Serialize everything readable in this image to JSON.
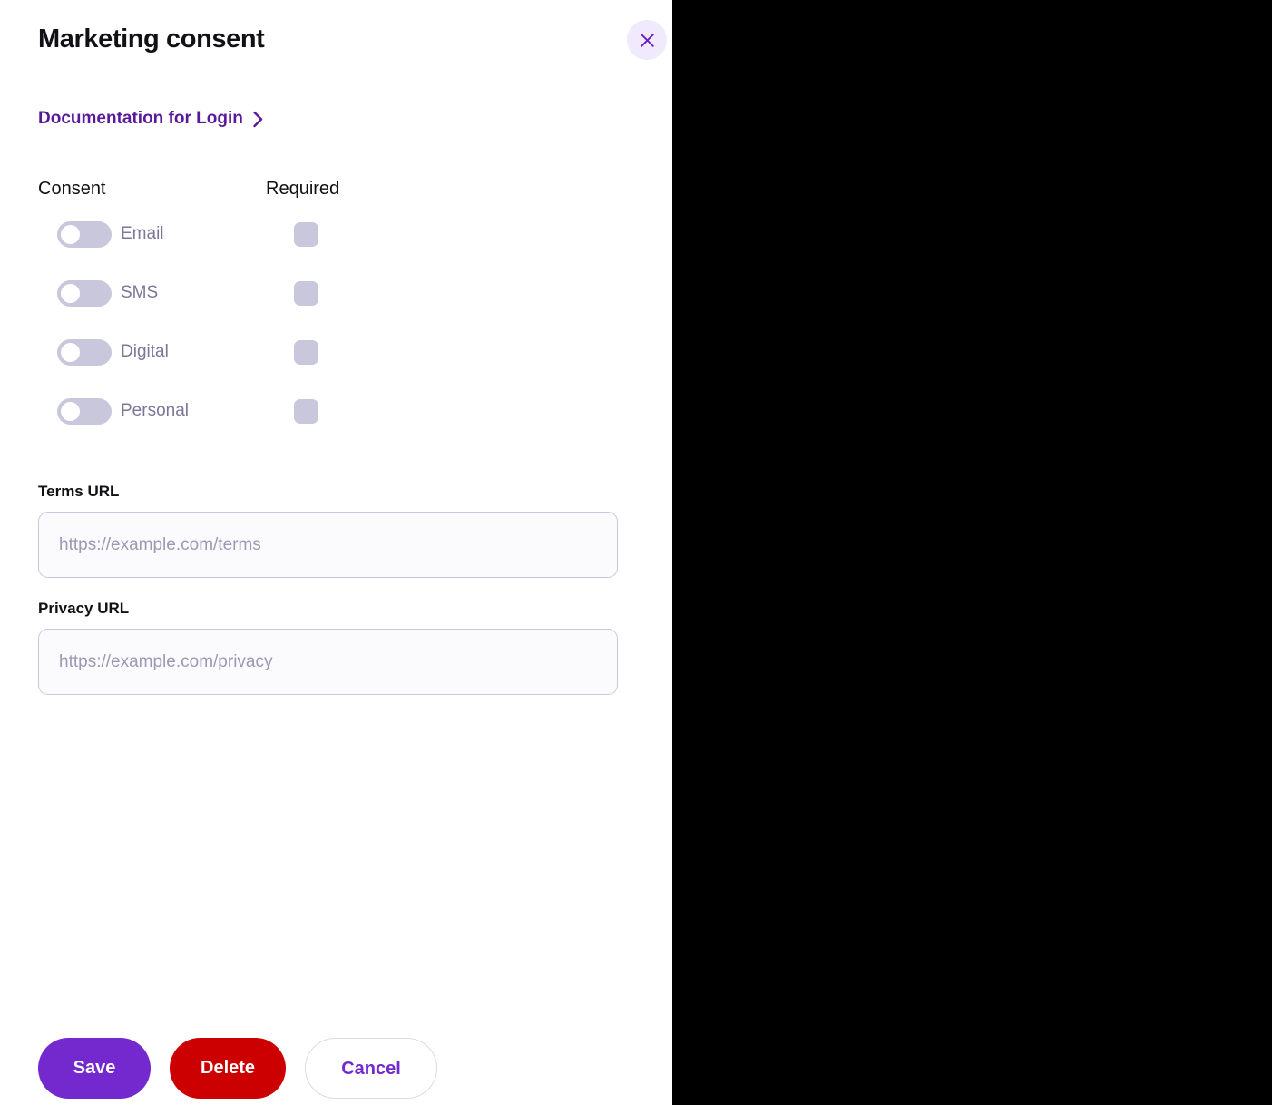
{
  "panel": {
    "title": "Marketing consent",
    "close_icon": "close-icon"
  },
  "doc_link": {
    "label": "Documentation for Login",
    "chevron_icon": "chevron-right-icon"
  },
  "consent_table": {
    "headers": {
      "consent": "Consent",
      "required": "Required"
    },
    "rows": [
      {
        "label": "Email",
        "toggle_state": "off",
        "required_state": "unchecked"
      },
      {
        "label": "SMS",
        "toggle_state": "off",
        "required_state": "unchecked"
      },
      {
        "label": "Digital",
        "toggle_state": "off",
        "required_state": "unchecked"
      },
      {
        "label": "Personal",
        "toggle_state": "off",
        "required_state": "unchecked"
      }
    ]
  },
  "fields": {
    "terms": {
      "label": "Terms URL",
      "value": "",
      "placeholder": "https://example.com/terms"
    },
    "privacy": {
      "label": "Privacy URL",
      "value": "",
      "placeholder": "https://example.com/privacy"
    }
  },
  "footer": {
    "save_label": "Save",
    "delete_label": "Delete",
    "cancel_label": "Cancel"
  },
  "colors": {
    "accent_purple": "#7429cf",
    "link_purple": "#5a189a",
    "danger_red": "#cc0000",
    "muted_lavender": "#c9c7dc",
    "label_text": "#7b7897",
    "panel_bg": "#ffffff",
    "backdrop": "#000000",
    "close_bg": "#f0eafc"
  }
}
